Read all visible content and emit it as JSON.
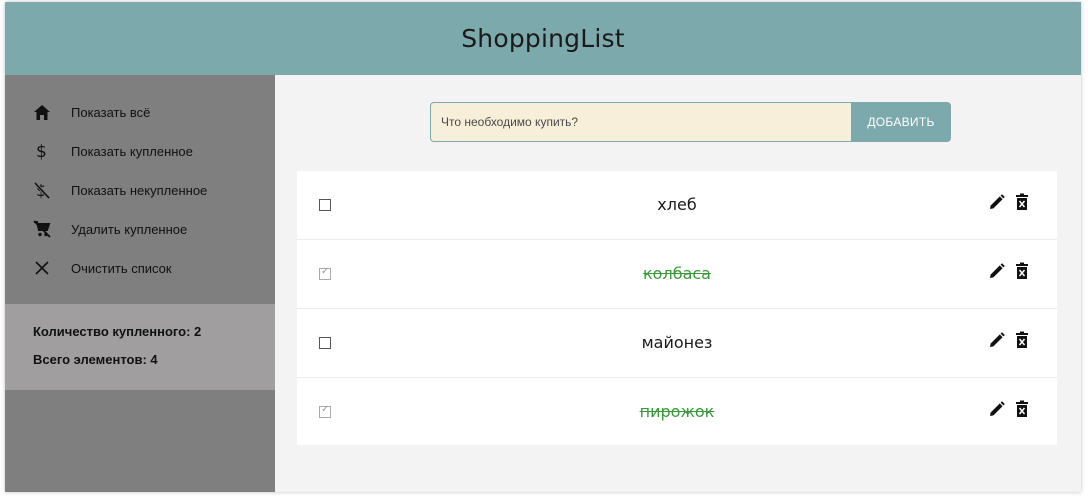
{
  "header": {
    "title": "ShoppingList"
  },
  "sidebar": {
    "items": [
      {
        "label": "Показать всё",
        "icon": "home-icon"
      },
      {
        "label": "Показать купленное",
        "icon": "dollar-icon"
      },
      {
        "label": "Показать некупленное",
        "icon": "dollar-off-icon"
      },
      {
        "label": "Удалить купленное",
        "icon": "remove-cart-icon"
      },
      {
        "label": "Очистить список",
        "icon": "close-icon"
      }
    ],
    "stats": {
      "bought": "Количество купленного: 2",
      "total": "Всего элементов: 4"
    }
  },
  "form": {
    "placeholder": "Что необходимо купить?",
    "value": "",
    "button": "ДОБАВИТЬ"
  },
  "items": [
    {
      "name": "хлеб",
      "bought": false
    },
    {
      "name": "колбаса",
      "bought": true
    },
    {
      "name": "майонез",
      "bought": false
    },
    {
      "name": "пирожок",
      "bought": true
    }
  ],
  "colors": {
    "header": "#7ca9ab",
    "sidebar": "#7f7f7f",
    "stats": "#a09e9e",
    "input_bg": "#f8efda",
    "bought_text": "#3a9a3a"
  }
}
